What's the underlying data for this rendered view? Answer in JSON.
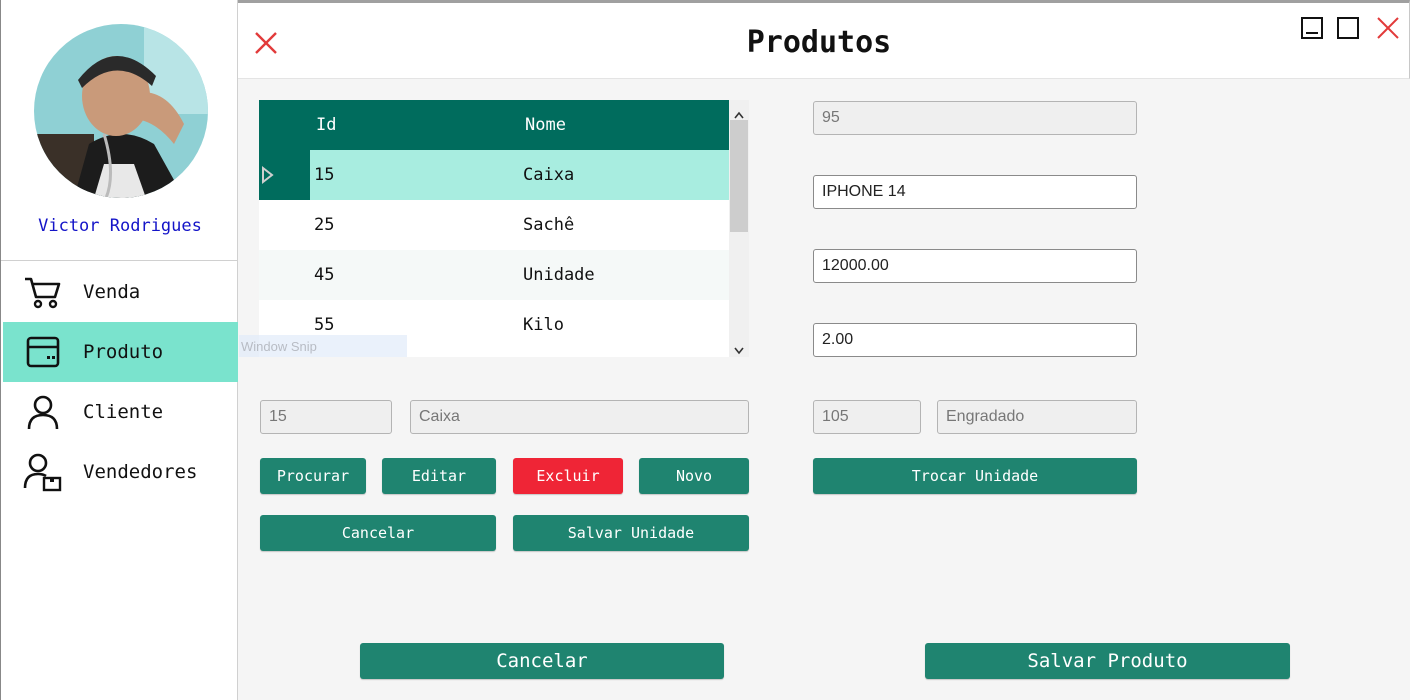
{
  "sidebar": {
    "user_name": "Victor Rodrigues",
    "items": [
      {
        "label": "Venda",
        "icon": "cart-icon"
      },
      {
        "label": "Produto",
        "icon": "box-icon"
      },
      {
        "label": "Cliente",
        "icon": "user-icon"
      },
      {
        "label": "Vendedores",
        "icon": "seller-icon"
      }
    ],
    "active_item": "Produto"
  },
  "header": {
    "title": "Produtos"
  },
  "table": {
    "columns": [
      "Id",
      "Nome"
    ],
    "rows": [
      {
        "id": "15",
        "nome": "Caixa"
      },
      {
        "id": "25",
        "nome": "Sachê"
      },
      {
        "id": "45",
        "nome": "Unidade"
      },
      {
        "id": "55",
        "nome": "Kilo"
      }
    ],
    "selected_row": 0
  },
  "overlay_text": "Window Snip",
  "unit_form": {
    "id_value": "15",
    "name_value": "Caixa",
    "buttons": {
      "procurar": "Procurar",
      "editar": "Editar",
      "excluir": "Excluir",
      "novo": "Novo",
      "cancelar": "Cancelar",
      "salvar_unidade": "Salvar Unidade"
    }
  },
  "product_form": {
    "id_value": "95",
    "name_value": "IPHONE 14",
    "price_value": "12000.00",
    "quantity_value": "2.00",
    "unit_id_value": "105",
    "unit_name_value": "Engradado",
    "trocar_unidade_label": "Trocar Unidade"
  },
  "footer": {
    "cancelar_label": "Cancelar",
    "salvar_produto_label": "Salvar Produto"
  },
  "colors": {
    "primary": "#1f8470",
    "header_dark": "#006c5d",
    "active_nav": "#7ae3cd",
    "selected_row": "#a8ede0",
    "danger": "#ef2536",
    "user_name": "#1414c8"
  }
}
